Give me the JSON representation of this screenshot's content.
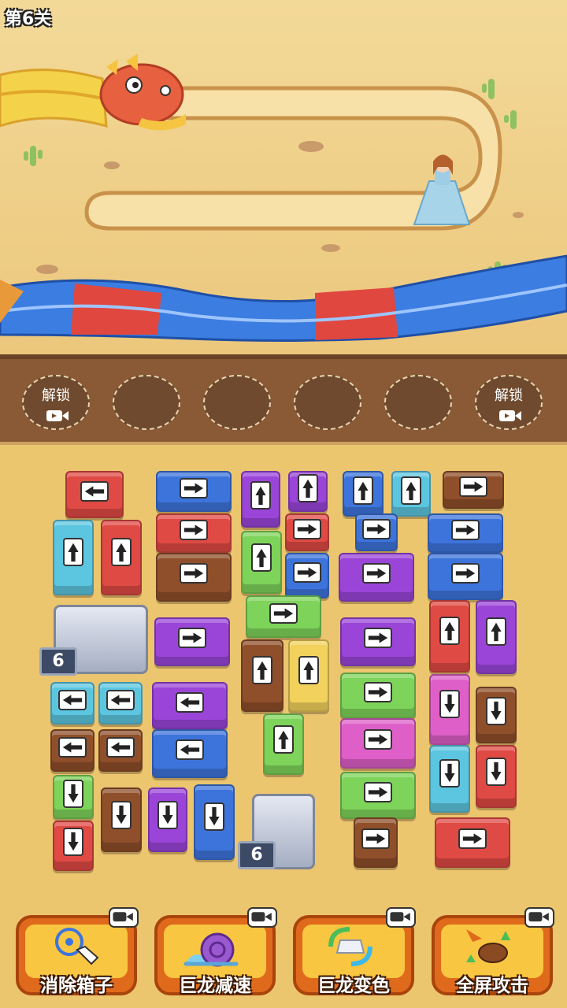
{
  "level": {
    "label": "第6关"
  },
  "slots": {
    "unlock_label": "解锁"
  },
  "colors": {
    "red": "#e04a44",
    "blue": "#3d74dc",
    "cyan": "#5cc6e0",
    "purple": "#9a45d8",
    "brown": "#8f4f2a",
    "green": "#7ed35a",
    "yellow": "#f2d25c",
    "magenta": "#de5fc8"
  },
  "boxes": [
    {
      "color": "red",
      "dir": "left"
    },
    {
      "color": "blue",
      "dir": "right"
    },
    {
      "color": "purple",
      "dir": "up"
    },
    {
      "color": "purple",
      "dir": "up"
    },
    {
      "color": "blue",
      "dir": "up"
    },
    {
      "color": "cyan",
      "dir": "up"
    },
    {
      "color": "brown",
      "dir": "right"
    },
    {
      "color": "cyan",
      "dir": "up"
    },
    {
      "color": "red",
      "dir": "up"
    },
    {
      "color": "red",
      "dir": "right"
    },
    {
      "color": "red",
      "dir": "right"
    },
    {
      "color": "blue",
      "dir": "right"
    },
    {
      "color": "blue",
      "dir": "right"
    },
    {
      "color": "green",
      "dir": "up"
    },
    {
      "color": "brown",
      "dir": "right"
    },
    {
      "color": "blue",
      "dir": "right"
    },
    {
      "color": "purple",
      "dir": "right"
    },
    {
      "color": "blue",
      "dir": "right"
    },
    {
      "color": "green",
      "dir": "right"
    },
    {
      "color": "purple",
      "dir": "right"
    },
    {
      "color": "purple",
      "dir": "right"
    },
    {
      "color": "red",
      "dir": "up"
    },
    {
      "color": "purple",
      "dir": "up"
    },
    {
      "color": "brown",
      "dir": "up"
    },
    {
      "color": "yellow",
      "dir": "up"
    },
    {
      "color": "cyan",
      "dir": "left"
    },
    {
      "color": "cyan",
      "dir": "left"
    },
    {
      "color": "purple",
      "dir": "left"
    },
    {
      "color": "green",
      "dir": "right"
    },
    {
      "color": "magenta",
      "dir": "down"
    },
    {
      "color": "brown",
      "dir": "down"
    },
    {
      "color": "green",
      "dir": "up"
    },
    {
      "color": "brown",
      "dir": "left"
    },
    {
      "color": "brown",
      "dir": "left"
    },
    {
      "color": "blue",
      "dir": "left"
    },
    {
      "color": "magenta",
      "dir": "right"
    },
    {
      "color": "cyan",
      "dir": "down"
    },
    {
      "color": "red",
      "dir": "down"
    },
    {
      "color": "green",
      "dir": "down"
    },
    {
      "color": "green",
      "dir": "right"
    },
    {
      "color": "brown",
      "dir": "down"
    },
    {
      "color": "purple",
      "dir": "down"
    },
    {
      "color": "blue",
      "dir": "down"
    },
    {
      "color": "red",
      "dir": "down"
    },
    {
      "color": "brown",
      "dir": "right"
    },
    {
      "color": "red",
      "dir": "right"
    }
  ],
  "tunnels": [
    {
      "count": "6"
    },
    {
      "count": "6"
    }
  ],
  "powerups": [
    {
      "label": "消除箱子",
      "icon": "target-tap-icon"
    },
    {
      "label": "巨龙减速",
      "icon": "snail-icon"
    },
    {
      "label": "巨龙变色",
      "icon": "color-swap-icon"
    },
    {
      "label": "全屏攻击",
      "icon": "explosion-icon"
    }
  ]
}
